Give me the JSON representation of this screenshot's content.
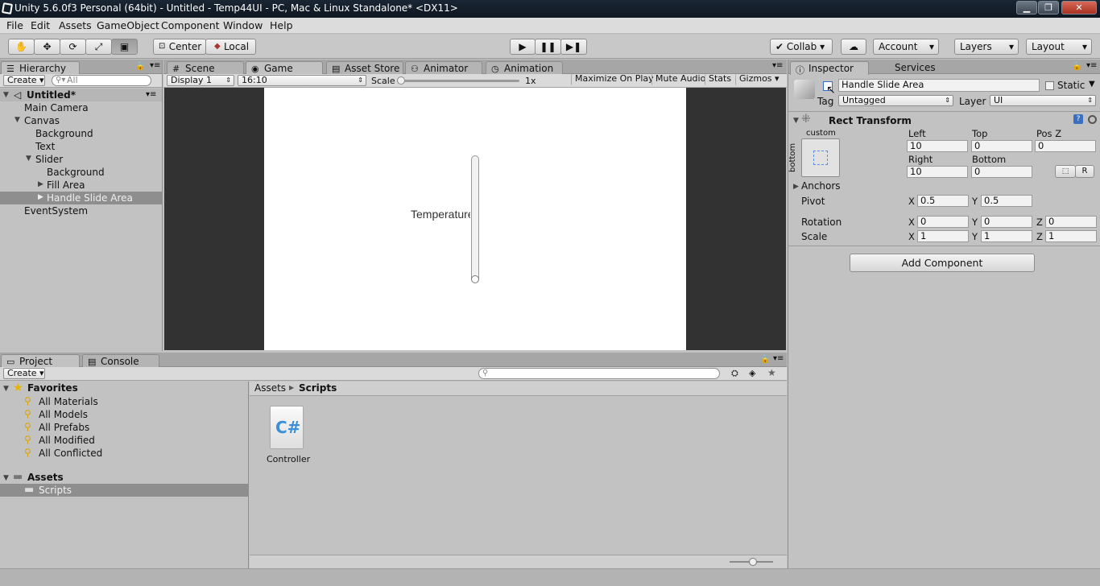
{
  "window": {
    "title": "Unity 5.6.0f3 Personal (64bit) - Untitled - Temp44UI - PC, Mac & Linux Standalone* <DX11>"
  },
  "menu": [
    "File",
    "Edit",
    "Assets",
    "GameObject",
    "Component",
    "Window",
    "Help"
  ],
  "toolbar": {
    "pivot_mode": "Center",
    "pivot_rotation": "Local",
    "collab": "Collab",
    "account": "Account",
    "layers": "Layers",
    "layout": "Layout"
  },
  "hierarchy": {
    "tab": "Hierarchy",
    "create": "Create",
    "search_placeholder": "All",
    "scene": "Untitled*",
    "items": [
      {
        "label": "Main Camera"
      },
      {
        "label": "Canvas"
      },
      {
        "label": "Background"
      },
      {
        "label": "Text"
      },
      {
        "label": "Slider"
      },
      {
        "label": "Background"
      },
      {
        "label": "Fill Area"
      },
      {
        "label": "Handle Slide Area"
      },
      {
        "label": "EventSystem"
      }
    ]
  },
  "center_tabs": [
    "Scene",
    "Game",
    "Asset Store",
    "Animator",
    "Animation"
  ],
  "game": {
    "display": "Display 1",
    "aspect": "16:10",
    "scale_label": "Scale",
    "scale_value": "1x",
    "maximize": "Maximize On Play",
    "mute": "Mute Audio",
    "stats": "Stats",
    "gizmos": "Gizmos",
    "canvas_text": "Temperature"
  },
  "inspector": {
    "tab": "Inspector",
    "services_tab": "Services",
    "object_name": "Handle Slide Area",
    "static_label": "Static",
    "tag_label": "Tag",
    "tag_value": "Untagged",
    "layer_label": "Layer",
    "layer_value": "UI",
    "component_title": "Rect Transform",
    "anchor_preset_top": "custom",
    "anchor_preset_side": "bottom",
    "left_label": "Left",
    "top_label": "Top",
    "posz_label": "Pos Z",
    "left_value": "10",
    "top_value": "0",
    "posz_value": "0",
    "right_label": "Right",
    "bottom_label": "Bottom",
    "right_value": "10",
    "bottom_value": "0",
    "r_button": "R",
    "anchors_label": "Anchors",
    "pivot_label": "Pivot",
    "pivot_x": "0.5",
    "pivot_y": "0.5",
    "rotation_label": "Rotation",
    "rot_x": "0",
    "rot_y": "0",
    "rot_z": "0",
    "scale_label": "Scale",
    "scale_x": "1",
    "scale_y": "1",
    "scale_z": "1",
    "axis_x": "X",
    "axis_y": "Y",
    "axis_z": "Z",
    "add_component": "Add Component"
  },
  "project": {
    "tab": "Project",
    "console_tab": "Console",
    "create": "Create",
    "favorites_label": "Favorites",
    "favorites": [
      "All Materials",
      "All Models",
      "All Prefabs",
      "All Modified",
      "All Conflicted"
    ],
    "assets_label": "Assets",
    "scripts_folder": "Scripts",
    "breadcrumb_root": "Assets",
    "breadcrumb_current": "Scripts",
    "file_name": "Controller",
    "file_icon_text": "C#"
  }
}
